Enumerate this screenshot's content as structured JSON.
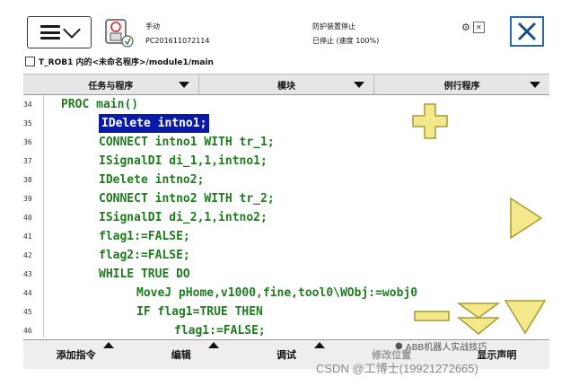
{
  "topbar": {
    "mode_line1": "手动",
    "mode_line2": "PC201611072114",
    "status_line1": "防护装置停止",
    "status_line2": "已停止 (速度 100%)"
  },
  "path": "T_ROB1 内的<未命名程序>/module1/main",
  "tabs": [
    {
      "label": "任务与程序"
    },
    {
      "label": "模块"
    },
    {
      "label": "例行程序"
    }
  ],
  "code_lines": [
    {
      "num": "34",
      "indent": 2,
      "text": "PROC main()"
    },
    {
      "num": "35",
      "indent": 3,
      "text": "IDelete intno1;",
      "selected": true
    },
    {
      "num": "36",
      "indent": 3,
      "text": "CONNECT intno1 WITH tr_1;"
    },
    {
      "num": "37",
      "indent": 3,
      "text": "ISignalDI di_1,1,intno1;"
    },
    {
      "num": "38",
      "indent": 3,
      "text": "IDelete intno2;"
    },
    {
      "num": "39",
      "indent": 3,
      "text": "CONNECT intno2 WITH tr_2;"
    },
    {
      "num": "40",
      "indent": 3,
      "text": "ISignalDI di_2,1,intno2;"
    },
    {
      "num": "41",
      "indent": 3,
      "text": "flag1:=FALSE;"
    },
    {
      "num": "42",
      "indent": 3,
      "text": "flag2:=FALSE;"
    },
    {
      "num": "43",
      "indent": 3,
      "text": "WHILE TRUE DO"
    },
    {
      "num": "44",
      "indent": 4,
      "text": "MoveJ pHome,v1000,fine,tool0\\WObj:=wobj0"
    },
    {
      "num": "45",
      "indent": 4,
      "text": "IF flag1=TRUE THEN"
    },
    {
      "num": "46",
      "indent": 5,
      "text": "flag1:=FALSE;"
    }
  ],
  "bottom": [
    {
      "label": "添加指令",
      "arrow": true
    },
    {
      "label": "编辑",
      "arrow": true
    },
    {
      "label": "调试",
      "arrow": true
    },
    {
      "label": "修改位置",
      "arrow": false,
      "disabled": true
    },
    {
      "label": "显示声明",
      "arrow": false
    }
  ],
  "watermark": {
    "line1": "ABB机器人实战技巧",
    "line2": "CSDN @工博士(19921272665)"
  },
  "colors": {
    "code_green": "#1e7c1e",
    "selection_blue": "#0a1aa8",
    "control_yellow": "#f3e98a",
    "close_blue": "#2b6aa8"
  }
}
